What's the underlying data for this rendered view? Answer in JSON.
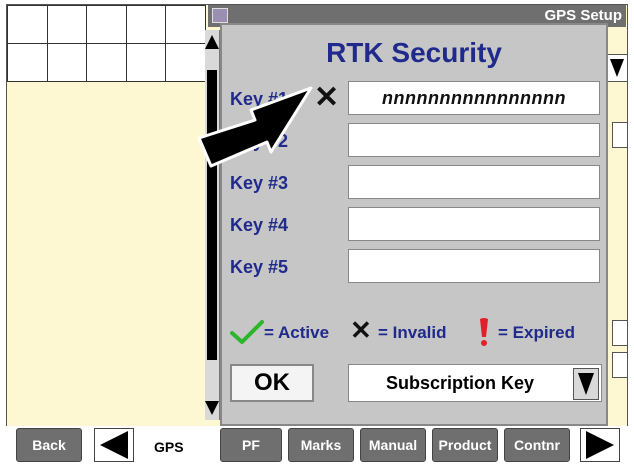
{
  "window": {
    "title": "GPS Setup"
  },
  "dialog": {
    "title": "RTK Security",
    "keys": [
      {
        "label": "Key #1",
        "value": "nnnnnnnnnnnnnnnn",
        "status": "invalid"
      },
      {
        "label": "Key #2",
        "value": ""
      },
      {
        "label": "Key #3",
        "value": ""
      },
      {
        "label": "Key #4",
        "value": ""
      },
      {
        "label": "Key #5",
        "value": ""
      }
    ],
    "legend": {
      "active": "= Active",
      "invalid": "= Invalid",
      "expired": "= Expired"
    },
    "ok_label": "OK",
    "subscription_select": "Subscription Key"
  },
  "bottom_nav": {
    "back": "Back",
    "gps": "GPS",
    "pf": "PF",
    "marks": "Marks",
    "manual": "Manual",
    "product": "Product",
    "contnr": "Contnr"
  },
  "colors": {
    "title_blue": "#1f2a8c",
    "active_green": "#2db52d",
    "expired_red": "#e0202a",
    "tab_gray": "#6f6f6f",
    "panel_yellow": "#fdf8d2"
  },
  "icons": [
    "check-icon",
    "x-icon",
    "exclamation-icon",
    "arrow-left-icon",
    "arrow-right-icon",
    "chevron-down-icon",
    "pointer-arrow-icon"
  ]
}
